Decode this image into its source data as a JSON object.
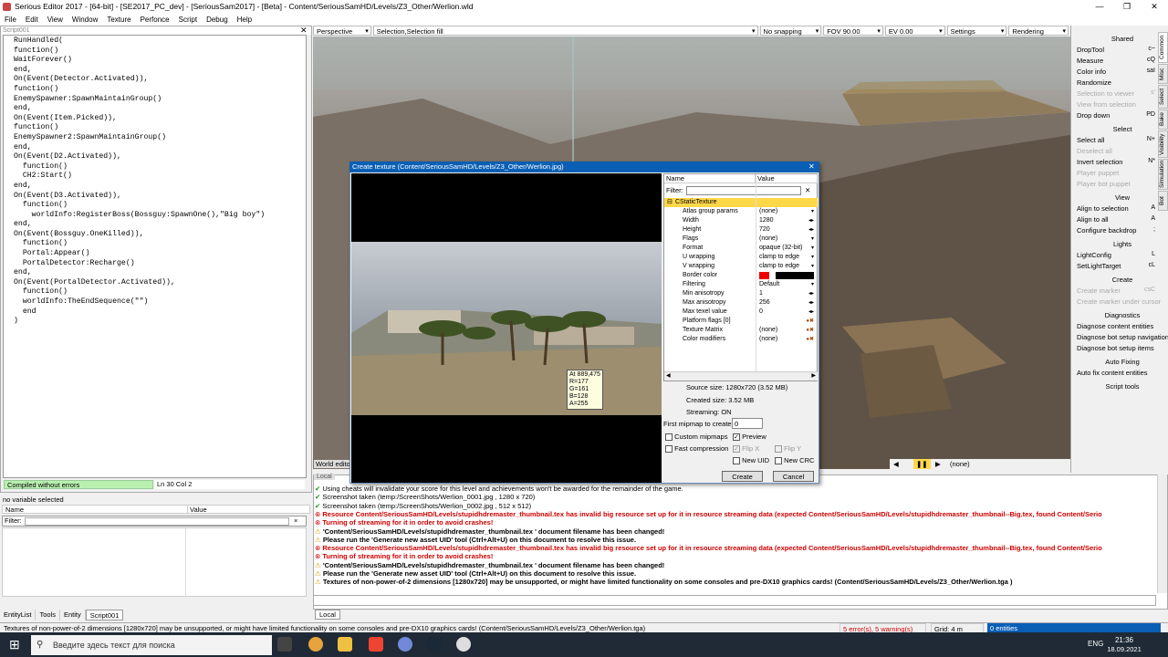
{
  "window": {
    "title": "Serious Editor 2017 - [64-bit] - [SE2017_PC_dev] - [SeriousSam2017] - [Beta] - Content/SeriousSamHD/Levels/Z3_Other/Werlion.wld"
  },
  "menu": [
    "File",
    "Edit",
    "View",
    "Window",
    "Texture",
    "Perfonce",
    "Script",
    "Debug",
    "Help"
  ],
  "script": {
    "tab": "Script001",
    "code": "RunHandled(\nfunction()\nWaitForever()\nend,\nOn(Event(Detector.Activated)),\nfunction()\nEnemySpawner:SpawnMaintainGroup()\nend,\nOn(Event(Item.Picked)),\nfunction()\nEnemySpawner2:SpawnMaintainGroup()\nend,\nOn(Event(D2.Activated)),\n  function()\n  CH2:Start()\nend,\nOn(Event(D3.Activated)),\n  function()\n    worldInfo:RegisterBoss(Bossguy:SpawnOne(),\"Big boy\")\nend,\nOn(Event(Bossguy.OneKilled)),\n  function()\n  Portal:Appear()\n  PortalDetector:Recharge()\nend,\nOn(Event(PortalDetector.Activated)),\n  function()\n  worldInfo:TheEndSequence(\"\")\n  end\n)",
    "status": "Compiled without errors",
    "position": "Ln 30  Col  2"
  },
  "variables": {
    "status": "no variable selected",
    "col_name": "Name",
    "col_value": "Value",
    "filter_label": "Filter:",
    "close": "×"
  },
  "left_tabs": [
    "EntityList",
    "Tools",
    "Entity",
    "Script001"
  ],
  "viewport": {
    "view": "Perspective",
    "selection": "Selection,Selection fill",
    "snapping": "No snapping",
    "fov": "FOV 90.00",
    "ev": "EV  0.00",
    "settings": "Settings",
    "rendering": "Rendering",
    "world_edit": "World edito",
    "play_value": "(none)"
  },
  "right_panel": {
    "tabs": [
      "Common",
      "Misc",
      "Select",
      "Bake",
      "Visibility",
      "Simulation",
      "Bot"
    ],
    "sections": [
      {
        "title": "Shared",
        "items": [
          {
            "label": "DropTool",
            "key": "c~",
            "enabled": true
          },
          {
            "label": "Measure",
            "key": "cQ",
            "enabled": true
          },
          {
            "label": "Color info",
            "key": "saI",
            "enabled": true
          },
          {
            "label": "Randomize",
            "key": "",
            "enabled": true
          },
          {
            "label": "Selection to viewer",
            "key": "s'",
            "enabled": false
          },
          {
            "label": "View from selection",
            "key": "",
            "enabled": false
          },
          {
            "label": "Drop down",
            "key": "PD",
            "enabled": true
          }
        ]
      },
      {
        "title": "Select",
        "items": [
          {
            "label": "Select all",
            "key": "N+",
            "enabled": true
          },
          {
            "label": "Deselect all",
            "key": "",
            "enabled": false
          },
          {
            "label": "Invert selection",
            "key": "N*",
            "enabled": true
          },
          {
            "label": "Player puppet",
            "key": "",
            "enabled": false
          },
          {
            "label": "Player bot puppet",
            "key": "",
            "enabled": false
          }
        ]
      },
      {
        "title": "View",
        "items": [
          {
            "label": "Align to selection",
            "key": "A",
            "enabled": true
          },
          {
            "label": "Align to all",
            "key": "A",
            "enabled": true
          },
          {
            "label": "Configure backdrop",
            "key": ";",
            "enabled": true
          }
        ]
      },
      {
        "title": "Lights",
        "items": [
          {
            "label": "LightConfig",
            "key": "L",
            "enabled": true
          },
          {
            "label": "SetLightTarget",
            "key": "cL",
            "enabled": true
          }
        ]
      },
      {
        "title": "Create",
        "items": [
          {
            "label": "Create marker",
            "key": "csC",
            "enabled": false
          },
          {
            "label": "Create marker under cursor",
            "key": "",
            "enabled": false
          }
        ]
      },
      {
        "title": "Diagnostics",
        "items": [
          {
            "label": "Diagnose content entities",
            "key": "",
            "enabled": true
          },
          {
            "label": "Diagnose bot setup navigation",
            "key": "",
            "enabled": true
          },
          {
            "label": "Diagnose bot setup items",
            "key": "",
            "enabled": true
          }
        ]
      },
      {
        "title": "Auto Fixing",
        "items": [
          {
            "label": "Auto fix content entities",
            "key": "",
            "enabled": true
          }
        ]
      },
      {
        "title": "Script tools",
        "items": []
      }
    ]
  },
  "dialog": {
    "title": "Create texture (Content/SeriousSamHD/Levels/Z3_Other/Werlion.jpg)",
    "pixel_info": [
      "At 889,475",
      "R=177",
      "G=161",
      "B=128",
      "A=255"
    ],
    "grid_header": {
      "name": "Name",
      "value": "Value"
    },
    "filter_label": "Filter:",
    "group": "CStaticTexture",
    "properties": [
      {
        "name": "Atlas group params",
        "value": "(none)",
        "ctl": "dd"
      },
      {
        "name": "Width",
        "value": "1280",
        "ctl": "spin"
      },
      {
        "name": "Height",
        "value": "720",
        "ctl": "spin"
      },
      {
        "name": "Flags",
        "value": "(none)",
        "ctl": "dd"
      },
      {
        "name": "Format",
        "value": "opaque (32-bit)",
        "ctl": "dd"
      },
      {
        "name": "U wrapping",
        "value": "clamp to edge",
        "ctl": "dd"
      },
      {
        "name": "V wrapping",
        "value": "clamp to edge",
        "ctl": "dd"
      },
      {
        "name": "Border color",
        "value": "",
        "ctl": "color"
      },
      {
        "name": "Filtering",
        "value": "Default",
        "ctl": "dd"
      },
      {
        "name": "Min anisotropy",
        "value": "1",
        "ctl": "spin"
      },
      {
        "name": "Max anisotropy",
        "value": "256",
        "ctl": "spin"
      },
      {
        "name": "Max texel value",
        "value": "0",
        "ctl": "spin"
      },
      {
        "name": "Platform flags [0]",
        "value": "",
        "ctl": "ptr"
      },
      {
        "name": "Texture Matrix",
        "value": "(none)",
        "ctl": "ptr"
      },
      {
        "name": "Color modifiers",
        "value": "(none)",
        "ctl": "ptr"
      }
    ],
    "source_size": "Source size: 1280x720 (3.52 MB)",
    "created_size": "Created size: 3.52 MB",
    "streaming": "Streaming: ON",
    "first_mipmap_label": "First mipmap to create",
    "first_mipmap_value": "0",
    "custom_mipmaps": "Custom mipmaps",
    "preview": "Preview",
    "fast_compression": "Fast compression",
    "flip_x": "Flip X",
    "flip_y": "Flip Y",
    "new_uid": "New UID",
    "new_crc": "New CRC",
    "create": "Create",
    "cancel": "Cancel"
  },
  "log": {
    "tab": "Local",
    "lines": [
      {
        "type": "ok",
        "text": "Using cheats will invalidate your score for this level and achievements won't be awarded for the remainder of the game."
      },
      {
        "type": "ok",
        "text": "Screenshot taken (temp:/ScreenShots/Werlion_0001.jpg , 1280 x 720)"
      },
      {
        "type": "ok",
        "text": "Screenshot taken (temp:/ScreenShots/Werlion_0002.jpg , 512 x 512)"
      },
      {
        "type": "err",
        "text": "Resource Content/SeriousSamHD/Levels/stupidhdremaster_thumbnail.tex  has invalid big resource set up for it in resource streaming data (expected Content/SeriousSamHD/Levels/stupidhdremaster_thumbnail--Big.tex, found Content/Serio"
      },
      {
        "type": "errsub",
        "text": "Turning of streaming for it in order to avoid crashes!"
      },
      {
        "type": "warn",
        "text": "'Content/SeriousSamHD/Levels/stupidhdremaster_thumbnail.tex ' document filename has been changed!"
      },
      {
        "type": "warnsub",
        "text": "Please run the 'Generate new asset UID' tool (Ctrl+Alt+U) on this document to resolve this issue."
      },
      {
        "type": "err",
        "text": "Resource Content/SeriousSamHD/Levels/stupidhdremaster_thumbnail.tex  has invalid big resource set up for it in resource streaming data (expected Content/SeriousSamHD/Levels/stupidhdremaster_thumbnail--Big.tex, found Content/Serio"
      },
      {
        "type": "errsub",
        "text": "Turning of streaming for it in order to avoid crashes!"
      },
      {
        "type": "warn",
        "text": "'Content/SeriousSamHD/Levels/stupidhdremaster_thumbnail.tex ' document filename has been changed!"
      },
      {
        "type": "warnsub",
        "text": "Please run the 'Generate new asset UID' tool (Ctrl+Alt+U) on this document to resolve this issue."
      },
      {
        "type": "warn",
        "text": "Textures of non-power-of-2 dimensions [1280x720] may be unsupported, or might have limited functionality on some consoles and pre-DX10 graphics cards! (Content/SeriousSamHD/Levels/Z3_Other/Werlion.tga )"
      }
    ],
    "bottom_tab": "Local"
  },
  "statusbar": {
    "message": "Textures of non-power-of-2 dimensions [1280x720] may be unsupported, or might have limited functionality on some consoles and pre-DX10 graphics cards! (Content/SeriousSamHD/Levels/Z3_Other/Werlion.tga)",
    "errors": "5 error(s), 5 warning(s)",
    "grid": "Grid: 4 m",
    "entities": "0 entities"
  },
  "taskbar": {
    "search_placeholder": "Введите здесь текст для поиска",
    "lang": "ENG",
    "time": "21:36",
    "date": "18.09.2021"
  }
}
